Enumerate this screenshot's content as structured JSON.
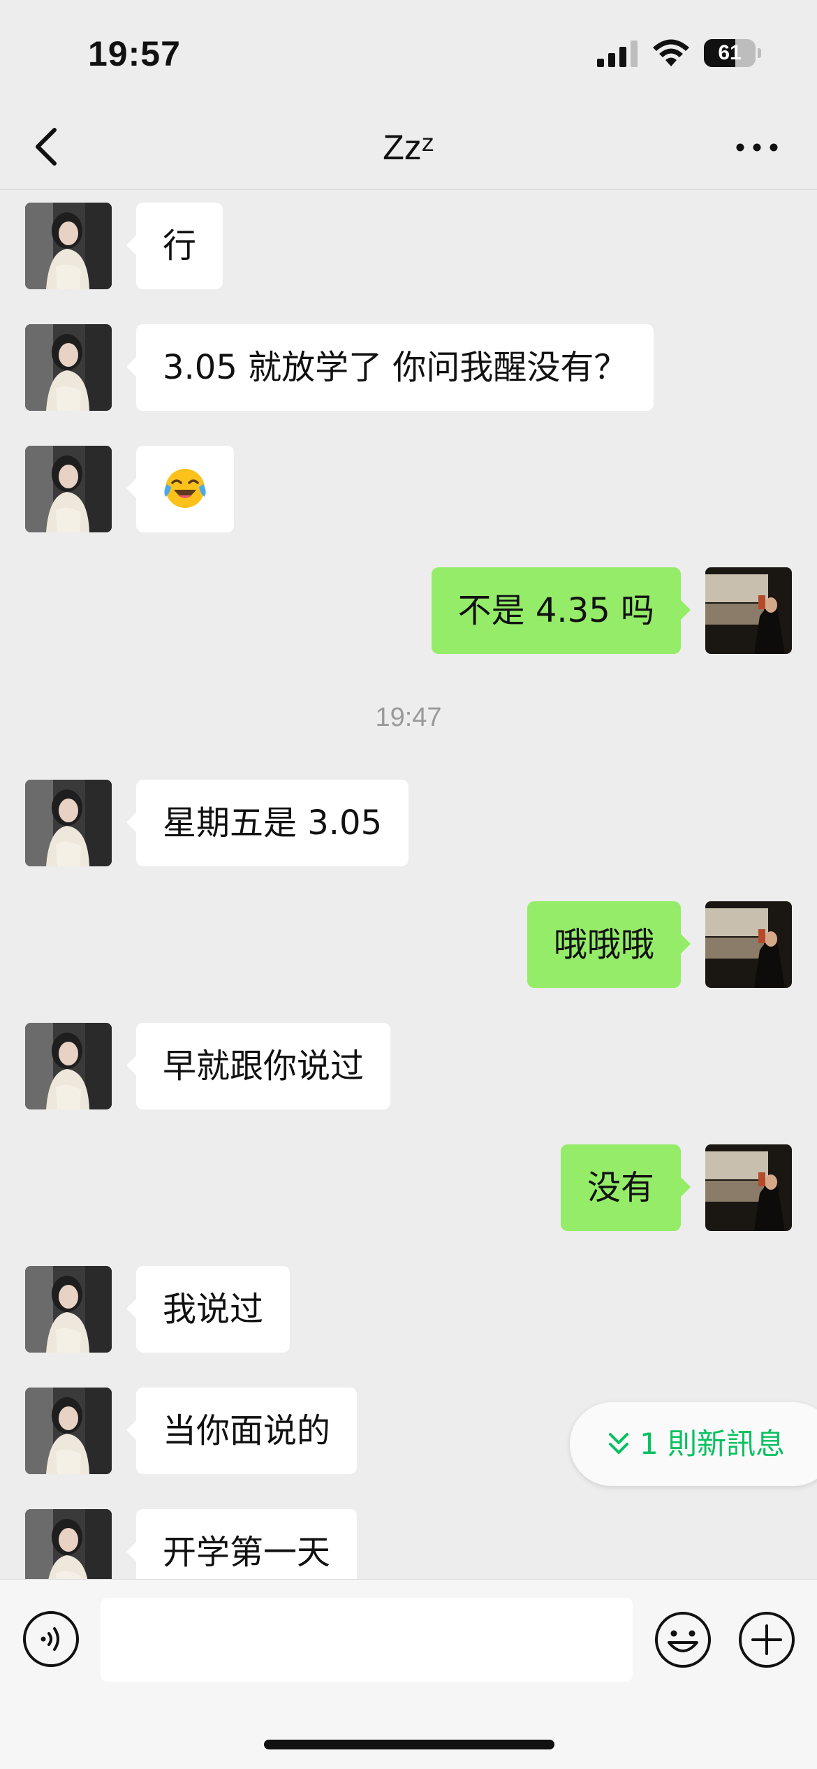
{
  "status_bar": {
    "time": "19:57",
    "battery": "61",
    "battery_level": 0.61
  },
  "nav": {
    "title": "Zzᶻ",
    "back_icon": "chevron-left-icon",
    "more_icon": "more-dots-icon"
  },
  "messages": [
    {
      "side": "other",
      "text": "行"
    },
    {
      "side": "other",
      "text": "3.05 就放学了 你问我醒没有？"
    },
    {
      "side": "other",
      "emoji": "crying-laughing-emoji"
    },
    {
      "side": "self",
      "text": "不是 4.35 吗"
    },
    {
      "side": "other",
      "text": "星期五是 3.05"
    },
    {
      "side": "self",
      "text": "哦哦哦"
    },
    {
      "side": "other",
      "text": "早就跟你说过"
    },
    {
      "side": "self",
      "text": "没有"
    },
    {
      "side": "other",
      "text": "我说过"
    },
    {
      "side": "other",
      "text": "当你面说的"
    },
    {
      "side": "other",
      "text": "开学第一天"
    }
  ],
  "time_separator": "19:47",
  "new_message_pill": {
    "text": "1 則新訊息",
    "icon": "double-chevron-down-icon"
  },
  "input_bar": {
    "voice_icon": "voice-icon",
    "input_value": "",
    "emoji_icon": "smiley-icon",
    "plus_icon": "plus-icon"
  },
  "colors": {
    "background": "#ededed",
    "self_bubble": "#95ec69",
    "other_bubble": "#ffffff",
    "accent": "#07c160"
  }
}
